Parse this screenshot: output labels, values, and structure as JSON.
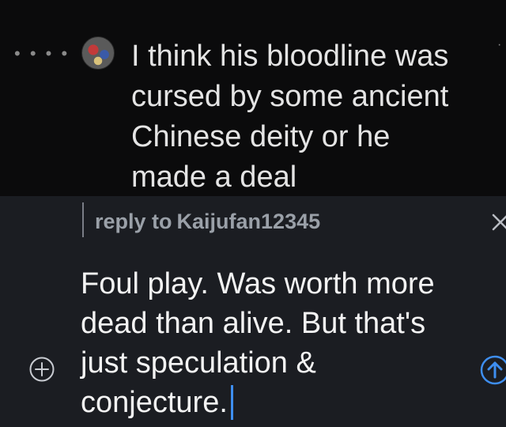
{
  "comment": {
    "text": "I think his bloodline was cursed by some ancient Chinese deity or he made a deal",
    "thread_indicator": "• • • •",
    "avatar": "avatar-image"
  },
  "composer": {
    "reply_prefix": "reply to",
    "reply_user": "Kaijufan12345",
    "draft_text": "Foul play. Was worth more dead than alive. But that's just speculation & conjecture.",
    "icons": {
      "close": "close-icon",
      "add": "plus-circle-icon",
      "send": "arrow-up-circle-icon"
    },
    "colors": {
      "background": "#1b1d22",
      "caret": "#3e8ef0",
      "send_accent": "#3e8ef0"
    }
  }
}
